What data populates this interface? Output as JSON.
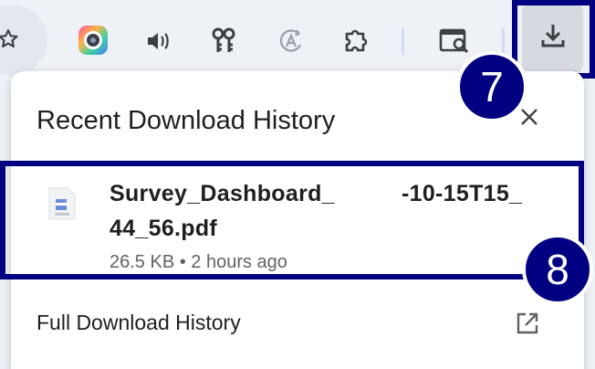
{
  "toolbar": {
    "icons": [
      "star-icon",
      "colorful-extension-icon",
      "speaker-icon",
      "keys-icon",
      "translate-icon",
      "puzzle-icon",
      "search-page-icon",
      "download-icon"
    ]
  },
  "callouts": {
    "download_button_number": "7",
    "item_number": "8"
  },
  "popup": {
    "title": "Recent Download History",
    "item": {
      "file_name_line1_start": "Survey_Dashboard_",
      "file_name_line1_end": "-10-15T15_",
      "file_name_line2": "44_56.pdf",
      "meta": "26.5 KB • 2 hours ago"
    },
    "full_history_label": "Full Download History"
  },
  "colors": {
    "callout": "#000080",
    "toolbar_bg": "#eef1f5",
    "icon": "#3c4043"
  }
}
